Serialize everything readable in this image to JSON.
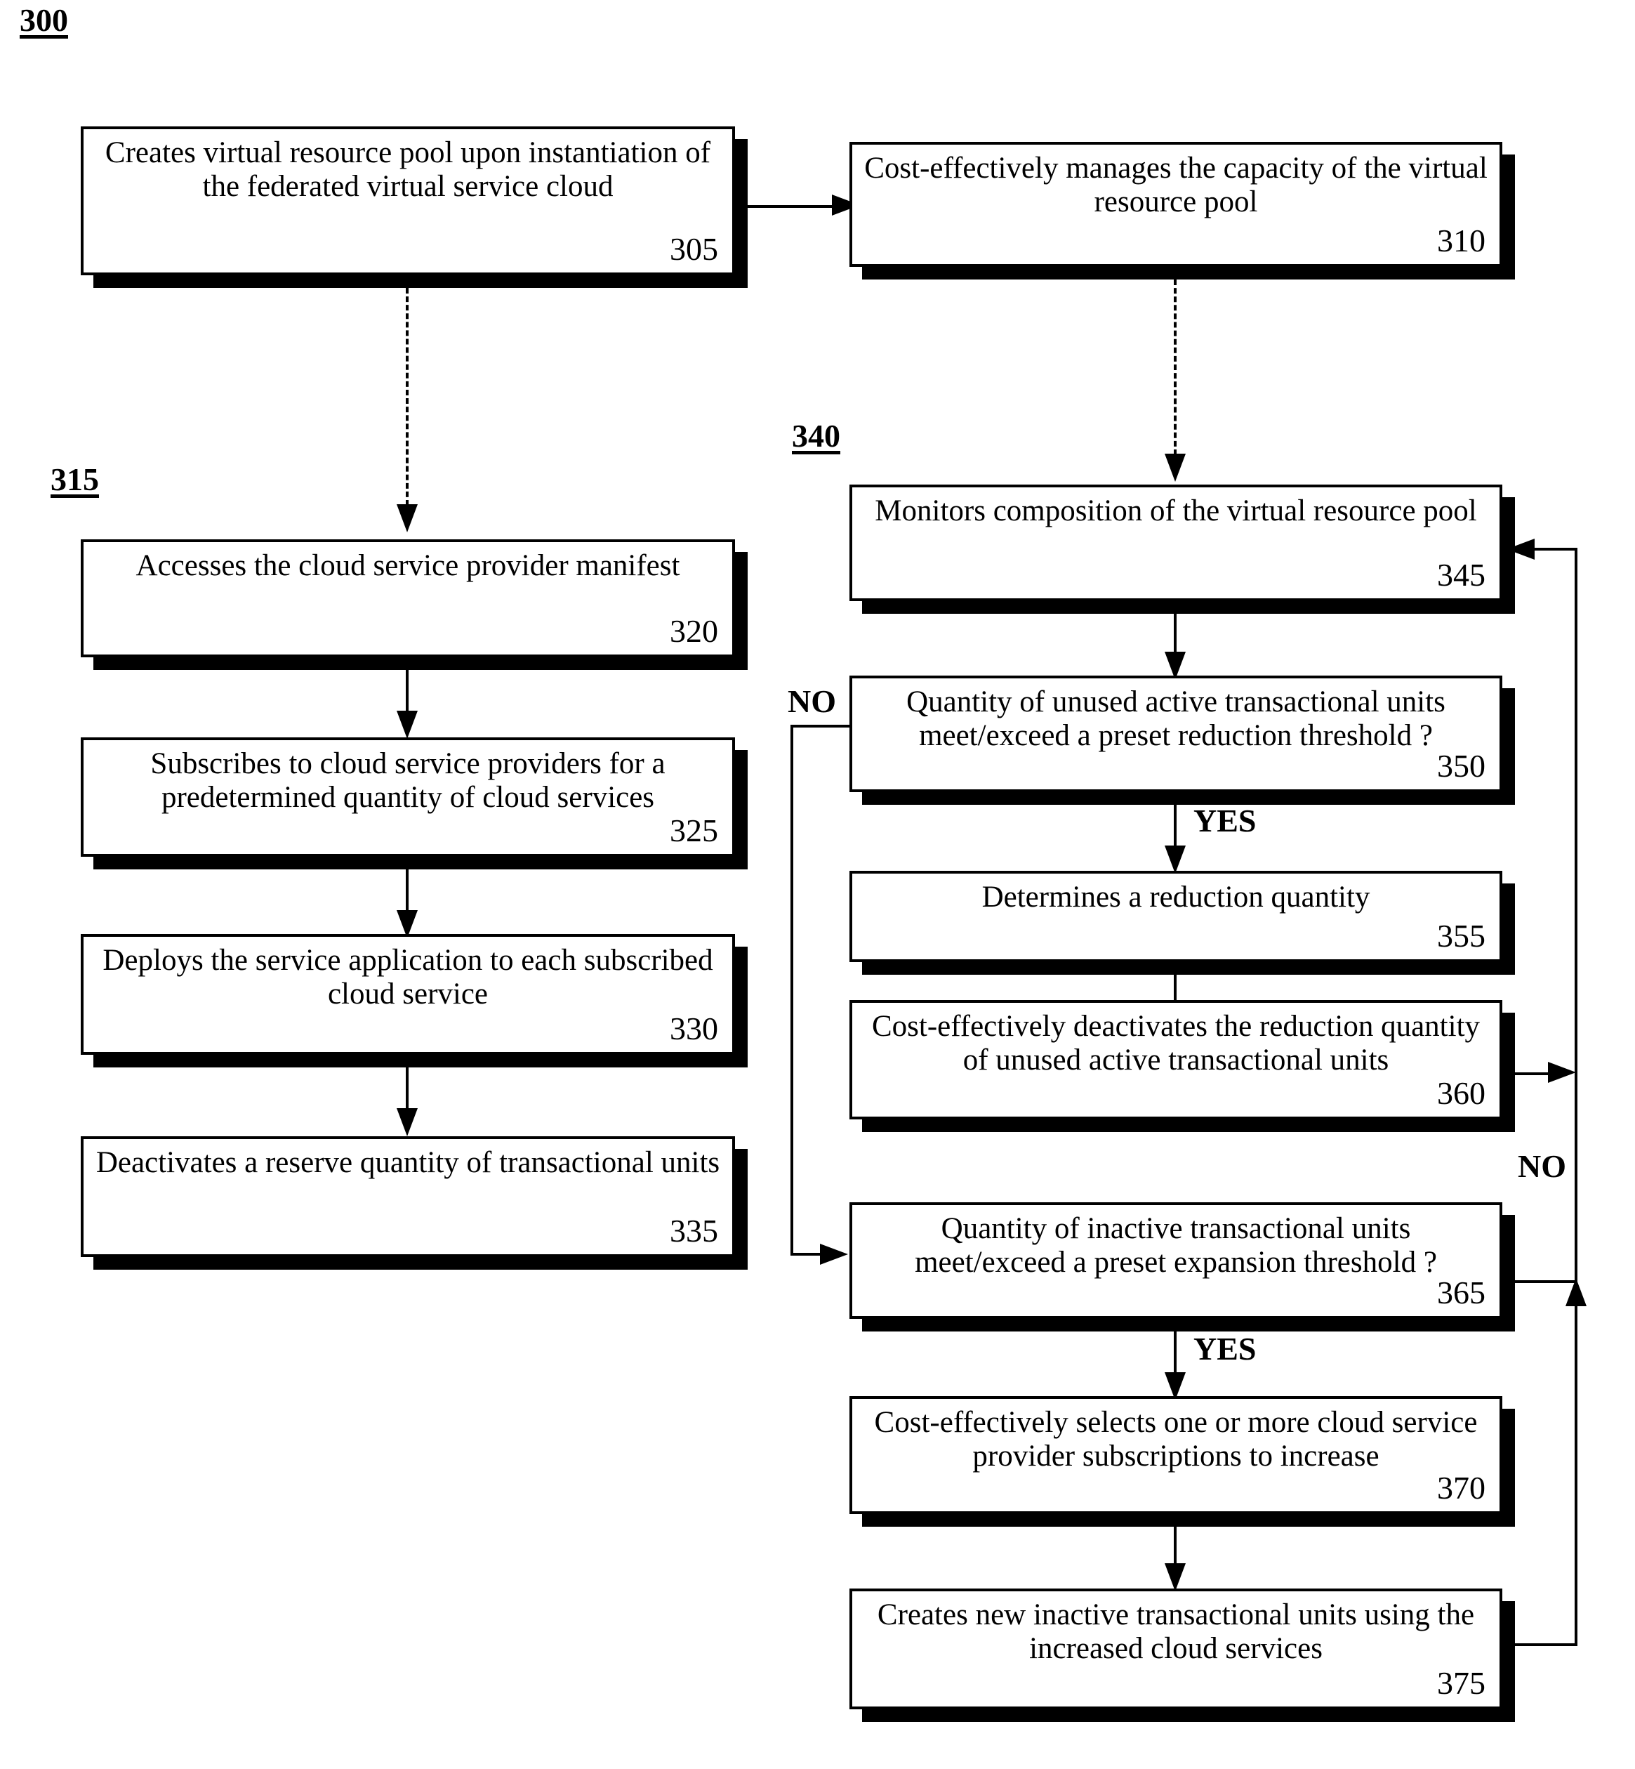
{
  "figure": {
    "number": "300"
  },
  "group_labels": {
    "left_group": "315",
    "right_group": "340"
  },
  "nodes": {
    "n305": {
      "text": "Creates virtual resource pool upon instantiation of the federated virtual service cloud",
      "number": "305"
    },
    "n310": {
      "text": "Cost-effectively manages the capacity of the virtual resource pool",
      "number": "310"
    },
    "n320": {
      "text": "Accesses the cloud service provider manifest",
      "number": "320"
    },
    "n325": {
      "text": "Subscribes to cloud service providers for a predetermined quantity of cloud services",
      "number": "325"
    },
    "n330": {
      "text": "Deploys the service application to each subscribed cloud service",
      "number": "330"
    },
    "n335": {
      "text": "Deactivates a reserve quantity of transactional units",
      "number": "335"
    },
    "n345": {
      "text": "Monitors composition of the virtual resource pool",
      "number": "345"
    },
    "n350": {
      "text": "Quantity of unused active transactional units meet/exceed a preset reduction threshold ?",
      "number": "350"
    },
    "n355": {
      "text": "Determines a reduction quantity",
      "number": "355"
    },
    "n360": {
      "text": "Cost-effectively deactivates the reduction quantity of unused active transactional units",
      "number": "360"
    },
    "n365": {
      "text": "Quantity of inactive transactional units meet/exceed a preset expansion threshold ?",
      "number": "365"
    },
    "n370": {
      "text": "Cost-effectively selects one or more cloud service provider subscriptions to increase",
      "number": "370"
    },
    "n375": {
      "text": "Creates new inactive transactional units using the increased cloud services",
      "number": "375"
    }
  },
  "branch_labels": {
    "no_350": "NO",
    "yes_350": "YES",
    "no_365": "NO",
    "yes_365": "YES"
  },
  "colors": {
    "stroke": "#000000",
    "fill": "#ffffff"
  }
}
